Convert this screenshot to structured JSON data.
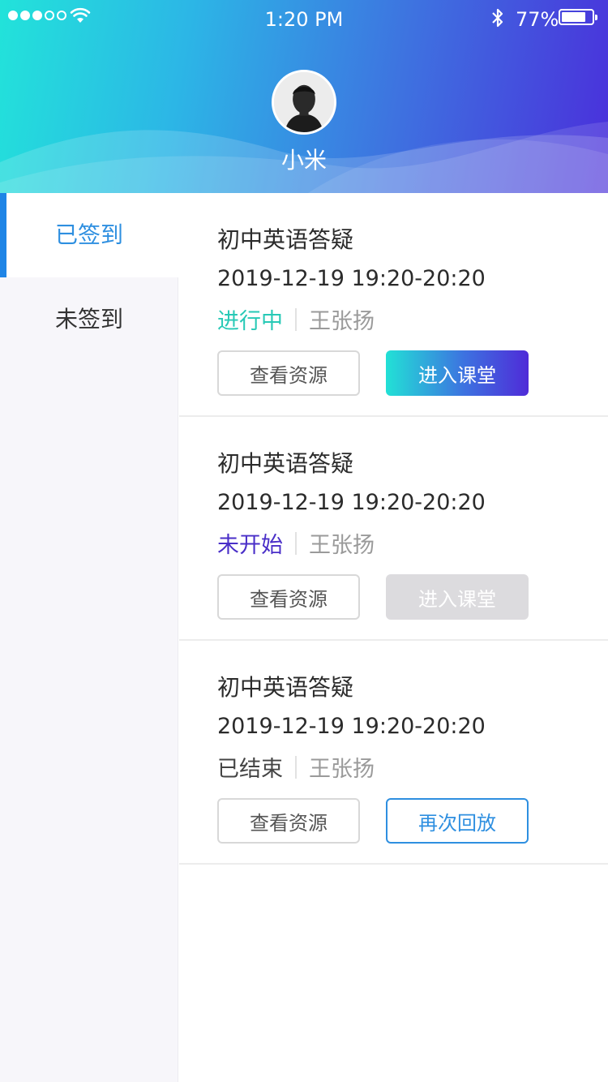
{
  "status_bar": {
    "time": "1:20 PM",
    "battery": "77%",
    "signal_filled": 3,
    "signal_total": 5
  },
  "profile": {
    "name": "小米"
  },
  "sidebar": {
    "items": [
      {
        "label": "已签到",
        "active": true
      },
      {
        "label": "未签到",
        "active": false
      }
    ]
  },
  "courses": [
    {
      "title": "初中英语答疑",
      "time": "2019-12-19 19:20-20:20",
      "status": "进行中",
      "teacher": "王张扬",
      "resource_button": "查看资源",
      "action_button": "进入课堂"
    },
    {
      "title": "初中英语答疑",
      "time": "2019-12-19 19:20-20:20",
      "status": "未开始",
      "teacher": "王张扬",
      "resource_button": "查看资源",
      "action_button": "进入课堂"
    },
    {
      "title": "初中英语答疑",
      "time": "2019-12-19 19:20-20:20",
      "status": "已结束",
      "teacher": "王张扬",
      "resource_button": "查看资源",
      "action_button": "再次回放"
    }
  ],
  "colors": {
    "accent_blue": "#2e8fe0",
    "status_ongoing": "#27c9b6",
    "status_not_started": "#4a2fc8",
    "gradient_start": "#22e3da",
    "gradient_end": "#4a2fdb",
    "disabled_button": "#dcdbde"
  }
}
